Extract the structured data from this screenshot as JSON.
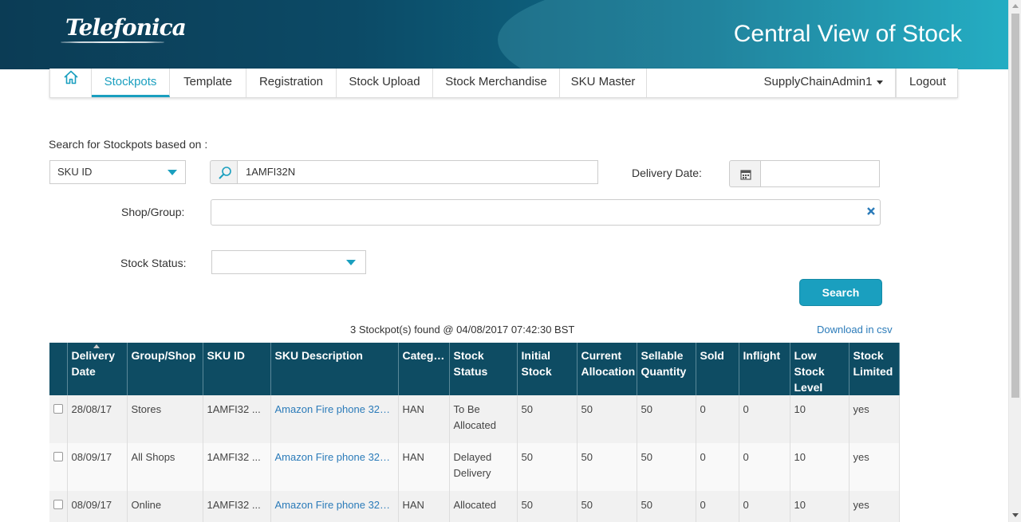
{
  "header": {
    "logo": "Telefonica",
    "title": "Central View of Stock"
  },
  "nav": {
    "items": [
      {
        "label": "Stockpots"
      },
      {
        "label": "Template"
      },
      {
        "label": "Registration"
      },
      {
        "label": "Stock Upload"
      },
      {
        "label": "Stock Merchandise"
      },
      {
        "label": "SKU Master"
      }
    ],
    "user": "SupplyChainAdmin1",
    "logout": "Logout"
  },
  "search": {
    "heading": "Search for Stockpots based on :",
    "field_select": "SKU ID",
    "query": "1AMFI32N",
    "delivery_date_label": "Delivery Date:",
    "delivery_date_value": "",
    "shop_group_label": "Shop/Group:",
    "shop_group_value": "",
    "stock_status_label": "Stock Status:",
    "stock_status_value": "",
    "button": "Search"
  },
  "results": {
    "summary": "3 Stockpot(s) found @ 04/08/2017 07:42:30 BST",
    "download": "Download in csv",
    "columns": [
      "Delivery Date",
      "Group/Shop",
      "SKU ID",
      "SKU Description",
      "Categor...",
      "Stock Status",
      "Initial Stock",
      "Current Allocation",
      "Sellable Quantity",
      "Sold",
      "Inflight",
      "Low Stock Level",
      "Stock Limited"
    ],
    "rows": [
      {
        "delivery_date": "28/08/17",
        "group_shop": "Stores",
        "sku_id": "1AMFI32 ...",
        "sku_desc": "Amazon Fire phone 32GB",
        "category": "HAN",
        "stock_status": "To Be Allocated",
        "initial_stock": "50",
        "current_allocation": "50",
        "sellable_quantity": "50",
        "sold": "0",
        "inflight": "0",
        "low_stock_level": "10",
        "stock_limited": "yes"
      },
      {
        "delivery_date": "08/09/17",
        "group_shop": "All Shops",
        "sku_id": "1AMFI32 ...",
        "sku_desc": "Amazon Fire phone 32GB",
        "category": "HAN",
        "stock_status": "Delayed Delivery",
        "initial_stock": "50",
        "current_allocation": "50",
        "sellable_quantity": "50",
        "sold": "0",
        "inflight": "0",
        "low_stock_level": "10",
        "stock_limited": "yes"
      },
      {
        "delivery_date": "08/09/17",
        "group_shop": "Online",
        "sku_id": "1AMFI32 ...",
        "sku_desc": "Amazon Fire phone 32GB",
        "category": "HAN",
        "stock_status": "Allocated",
        "initial_stock": "50",
        "current_allocation": "50",
        "sellable_quantity": "50",
        "sold": "0",
        "inflight": "0",
        "low_stock_level": "10",
        "stock_limited": "yes"
      }
    ]
  },
  "colors": {
    "accent": "#1a9fbf",
    "table_header": "#0e4c63",
    "link": "#2b7bb9"
  }
}
